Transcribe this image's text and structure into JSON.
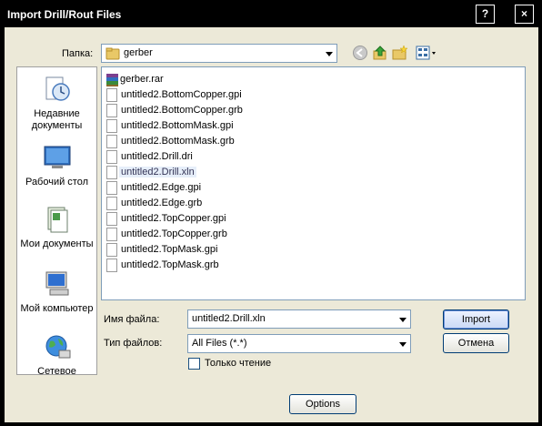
{
  "window": {
    "title": "Import Drill/Rout Files"
  },
  "titlebar_buttons": {
    "help": "?",
    "close": "×"
  },
  "look_in": {
    "label": "Папка:",
    "value": "gerber"
  },
  "places": [
    {
      "label": "Недавние документы",
      "icon": "recent-documents-icon"
    },
    {
      "label": "Рабочий стол",
      "icon": "desktop-icon"
    },
    {
      "label": "Мои документы",
      "icon": "my-documents-icon"
    },
    {
      "label": "Мой компьютер",
      "icon": "my-computer-icon"
    },
    {
      "label": "Сетевое",
      "icon": "network-icon"
    }
  ],
  "files": [
    {
      "name": "gerber.rar",
      "icon": "rar-archive-icon"
    },
    {
      "name": "untitled2.BottomCopper.gpi",
      "icon": "file-icon"
    },
    {
      "name": "untitled2.BottomCopper.grb",
      "icon": "file-icon"
    },
    {
      "name": "untitled2.BottomMask.gpi",
      "icon": "file-icon"
    },
    {
      "name": "untitled2.BottomMask.grb",
      "icon": "file-icon"
    },
    {
      "name": "untitled2.Drill.dri",
      "icon": "file-icon"
    },
    {
      "name": "untitled2.Drill.xln",
      "icon": "file-icon",
      "selected": true
    },
    {
      "name": "untitled2.Edge.gpi",
      "icon": "file-icon"
    },
    {
      "name": "untitled2.Edge.grb",
      "icon": "file-icon"
    },
    {
      "name": "untitled2.TopCopper.gpi",
      "icon": "file-icon"
    },
    {
      "name": "untitled2.TopCopper.grb",
      "icon": "file-icon"
    },
    {
      "name": "untitled2.TopMask.gpi",
      "icon": "file-icon"
    },
    {
      "name": "untitled2.TopMask.grb",
      "icon": "file-icon"
    }
  ],
  "filename": {
    "label": "Имя файла:",
    "value": "untitled2.Drill.xln"
  },
  "filetype": {
    "label": "Тип файлов:",
    "value": "All Files (*.*)"
  },
  "readonly": {
    "label": "Только чтение",
    "checked": false
  },
  "buttons": {
    "import": "Import",
    "cancel": "Отмена",
    "options": "Options"
  }
}
